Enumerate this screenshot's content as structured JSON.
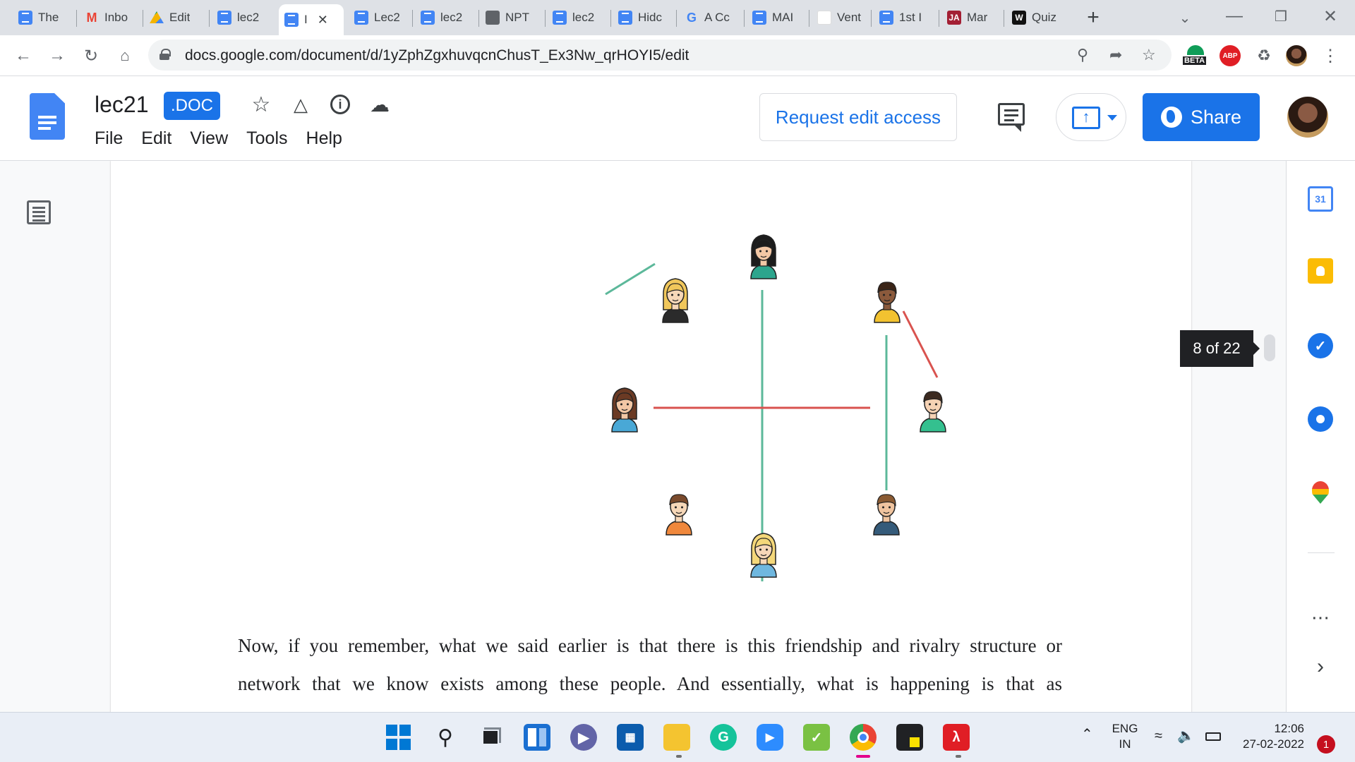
{
  "browser": {
    "tabs": [
      {
        "title": "The",
        "icon": "docs-icon"
      },
      {
        "title": "Inbo",
        "icon": "gmail-icon"
      },
      {
        "title": "Edit",
        "icon": "drive-icon"
      },
      {
        "title": "lec2",
        "icon": "docs-icon"
      },
      {
        "title": "I",
        "icon": "docs-icon",
        "active": true
      },
      {
        "title": "Lec2",
        "icon": "docs-icon"
      },
      {
        "title": "lec2",
        "icon": "docs-icon"
      },
      {
        "title": "NPT",
        "icon": "globe-icon"
      },
      {
        "title": "lec2",
        "icon": "docs-icon"
      },
      {
        "title": "Hidc",
        "icon": "docs-icon"
      },
      {
        "title": "A Cc",
        "icon": "google-icon"
      },
      {
        "title": "MAI",
        "icon": "docs-icon"
      },
      {
        "title": "Vent",
        "icon": "blank-icon"
      },
      {
        "title": "1st I",
        "icon": "docs-icon"
      },
      {
        "title": "Mar",
        "icon": "ja-icon",
        "badge": "JA"
      },
      {
        "title": "Quiz",
        "icon": "w-icon",
        "badge": "W"
      }
    ],
    "url": "docs.google.com/document/d/1yZphZgxhuvqcnChusT_Ex3Nw_qrHOYI5/edit",
    "extension_badges": {
      "beta": "BETA",
      "abp": "ABP"
    }
  },
  "doc": {
    "title": "lec21",
    "badge": ".DOC",
    "menu": [
      "File",
      "Edit",
      "View",
      "Tools",
      "Help"
    ],
    "request_access_label": "Request edit access",
    "share_label": "Share"
  },
  "page_indicator": "8 of 22",
  "paragraph": {
    "line1": "Now, if you remember, what we said earlier is that there is this friendship and rivalry structure or",
    "line2": "network that we know exists among these people. And essentially, what is happening is that as"
  },
  "diagram": {
    "friendship_color": "#5cb89a",
    "rivalry_color": "#d9534f"
  },
  "side_panel": {
    "calendar_day": "31"
  },
  "taskbar": {
    "lang_top": "ENG",
    "lang_bottom": "IN",
    "time": "12:06",
    "date": "27-02-2022",
    "notifications": "1"
  }
}
